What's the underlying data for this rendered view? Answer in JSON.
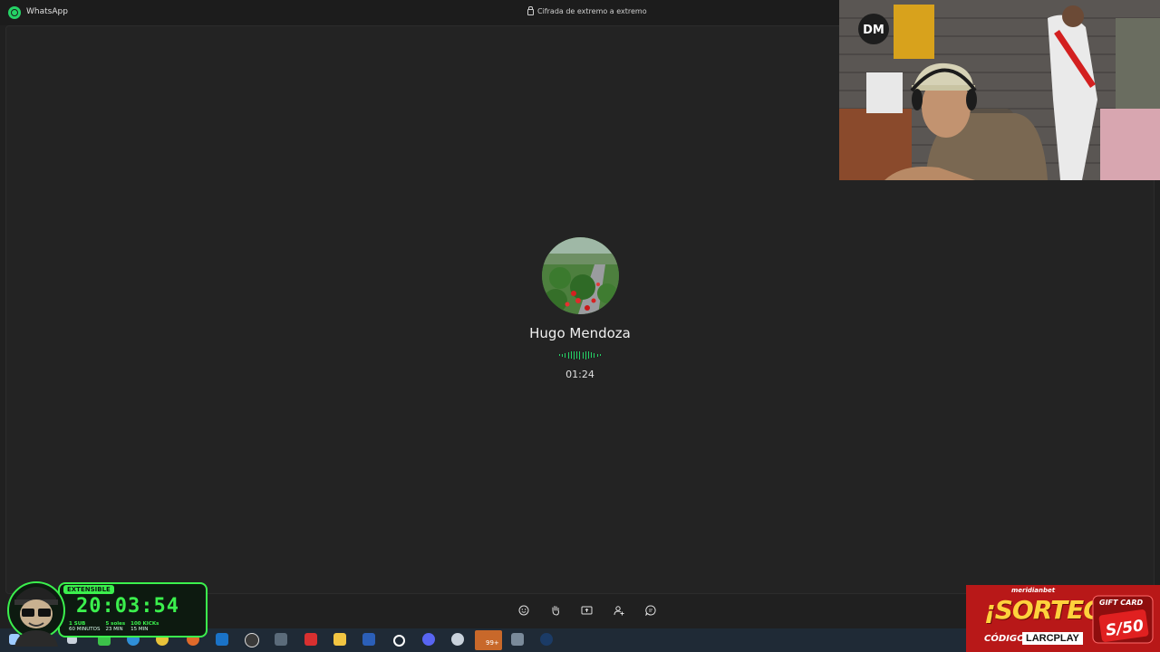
{
  "window": {
    "app_name": "WhatsApp",
    "encryption_notice": "Cifrada de extremo a extremo"
  },
  "call": {
    "caller_name": "Hugo Mendoza",
    "duration": "01:24",
    "controls": [
      {
        "icon": "emoji-icon"
      },
      {
        "icon": "raise-hand-icon"
      },
      {
        "icon": "share-screen-icon"
      },
      {
        "icon": "add-participant-icon"
      },
      {
        "icon": "chat-icon"
      }
    ]
  },
  "colors": {
    "background": "#202020",
    "accent": "#25d366"
  },
  "overlay": {
    "subathon": {
      "tag": "EXTENSIBLE",
      "clock": "20:03:54",
      "stats": [
        {
          "top": "1 SUB",
          "bottom": "60 MINUTOS"
        },
        {
          "top": "5 soles",
          "bottom": "23 MIN"
        },
        {
          "top": "100 KICKs",
          "bottom": "15 MIN"
        }
      ]
    },
    "promo": {
      "brand": "meridianbet",
      "headline": "¡SORTEO!",
      "code_label": "CÓDIGO:",
      "code": "LARCPLAY",
      "gift_label": "GIFT CARD",
      "amount": "S/50"
    }
  },
  "taskbar": {
    "badge": "99+"
  }
}
